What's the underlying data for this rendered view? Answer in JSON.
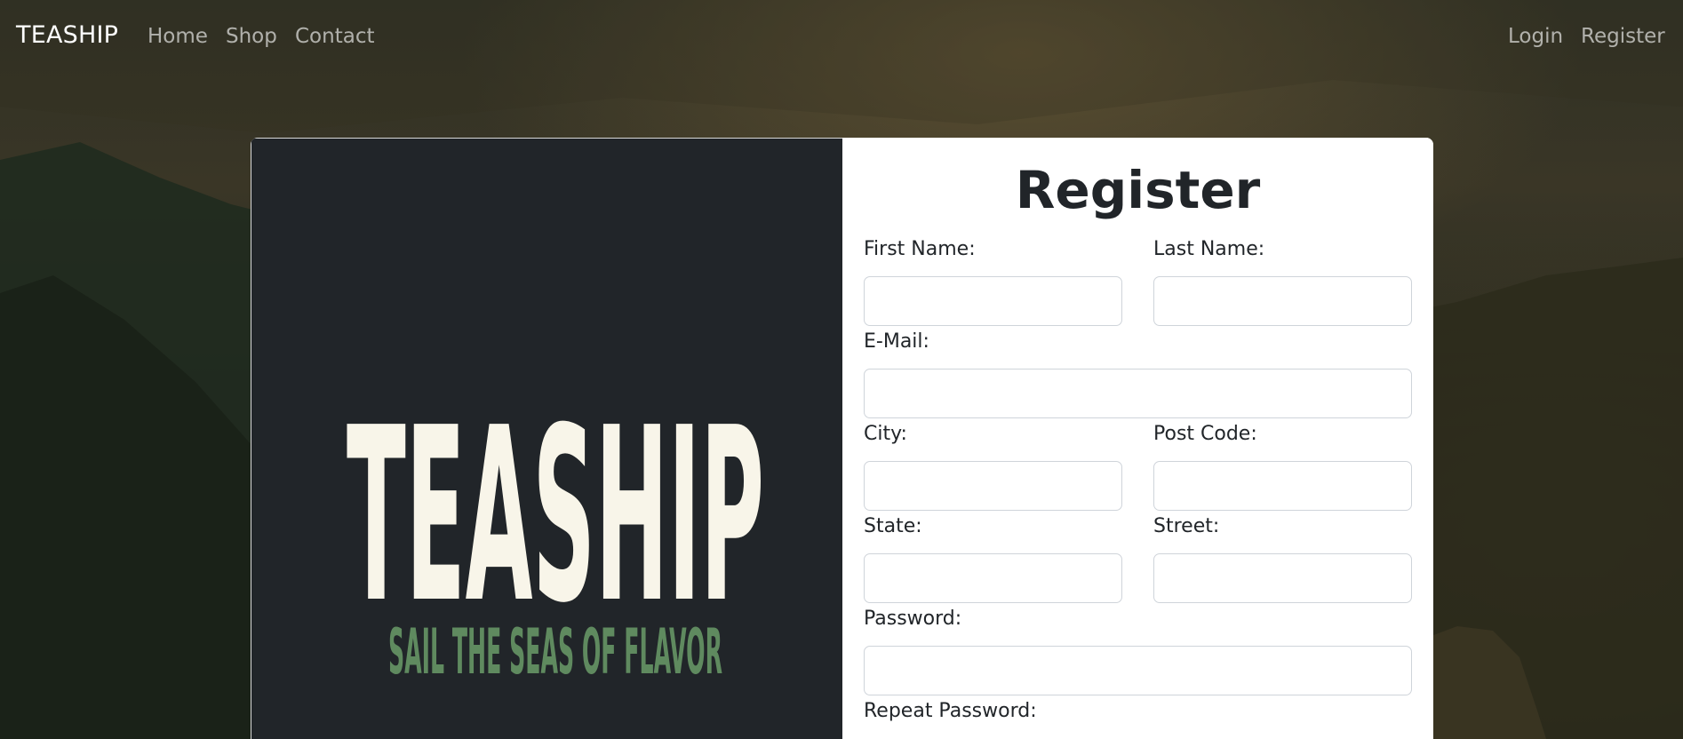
{
  "navbar": {
    "brand": "TEASHIP",
    "links": [
      "Home",
      "Shop",
      "Contact"
    ],
    "auth_links": [
      "Login",
      "Register"
    ]
  },
  "logo": {
    "title": "TEASHIP",
    "tagline": "SAIL THE SEAS OF FLAVOR",
    "colors": {
      "title": "#f8f5e9",
      "tagline": "#5f8a5f",
      "panel": "#212529"
    }
  },
  "form": {
    "title": "Register",
    "fields": {
      "first_name": {
        "label": "First Name:",
        "value": ""
      },
      "last_name": {
        "label": "Last Name:",
        "value": ""
      },
      "email": {
        "label": "E-Mail:",
        "value": ""
      },
      "city": {
        "label": "City:",
        "value": ""
      },
      "post_code": {
        "label": "Post Code:",
        "value": ""
      },
      "state": {
        "label": "State:",
        "value": ""
      },
      "street": {
        "label": "Street:",
        "value": ""
      },
      "password": {
        "label": "Password:",
        "value": ""
      },
      "repeat_password": {
        "label": "Repeat Password:",
        "value": ""
      }
    }
  }
}
